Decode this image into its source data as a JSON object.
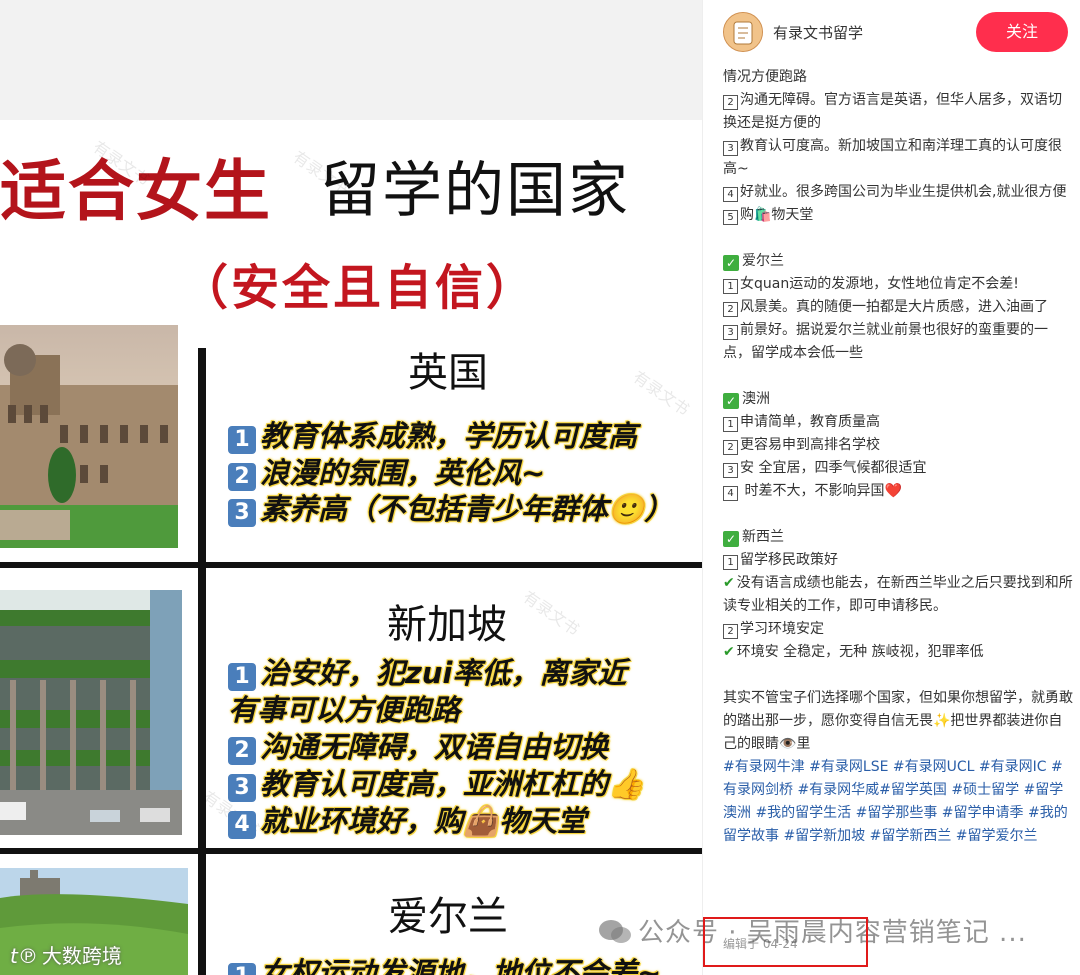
{
  "poster": {
    "title_red": "适合女生",
    "title_black": "留学的国家",
    "subtitle": "（安全且自信）",
    "watermark": "有录文书",
    "logo_watermark": "大数跨境",
    "sections": [
      {
        "country": "英国",
        "points": [
          "教育体系成熟，学历认可度高",
          "浪漫的氛围，英伦风~",
          "素养高（不包括青少年群体🙂）"
        ]
      },
      {
        "country": "新加坡",
        "points": [
          "治安好，犯zui率低，离家近",
          "有事可以方便跑路",
          "沟通无障碍，双语自由切换",
          "教育认可度高，亚洲杠杠的👍",
          "就业环境好，购👜物天堂"
        ]
      },
      {
        "country": "爱尔兰",
        "points": [
          "女权运动发源地，地位不会差~"
        ]
      }
    ]
  },
  "header": {
    "author": "有录文书留学",
    "follow_label": "关注"
  },
  "post": {
    "lines_top": [
      "情况方便跑路"
    ],
    "sg_items": [
      {
        "n": "2",
        "text": "沟通无障碍。官方语言是英语，但华人居多，双语切换还是挺方便的"
      },
      {
        "n": "3",
        "text": "教育认可度高。新加坡国立和南洋理工真的认可度很高~"
      },
      {
        "n": "4",
        "text": "好就业。很多跨国公司为毕业生提供机会,就业很方便"
      },
      {
        "n": "5",
        "text": "购🛍️物天堂"
      }
    ],
    "ireland_title": "爱尔兰",
    "ireland_items": [
      {
        "n": "1",
        "text": "女quan运动的发源地，女性地位肯定不会差!"
      },
      {
        "n": "2",
        "text": "风景美。真的随便一拍都是大片质感，进入油画了"
      },
      {
        "n": "3",
        "text": "前景好。据说爱尔兰就业前景也很好的蛮重要的一点，留学成本会低一些"
      }
    ],
    "australia_title": "澳洲",
    "australia_items": [
      {
        "n": "1",
        "text": "申请简单，教育质量高"
      },
      {
        "n": "2",
        "text": "更容易申到高排名学校"
      },
      {
        "n": "3",
        "text": "安 全宜居，四季气候都很适宜"
      },
      {
        "n": "4",
        "text": " 时差不大，不影响异国❤️"
      }
    ],
    "nz_title": "新西兰",
    "nz_items": [
      {
        "type": "box",
        "n": "1",
        "text": "留学移民政策好"
      },
      {
        "type": "tick",
        "text": "没有语言成绩也能去，在新西兰毕业之后只要找到和所读专业相关的工作，即可申请移民。"
      },
      {
        "type": "box",
        "n": "2",
        "text": "学习环境安定"
      },
      {
        "type": "tick",
        "text": "环境安 全稳定，无种 族岐视，犯罪率低"
      }
    ],
    "closing": "其实不管宝子们选择哪个国家，但如果你想留学，就勇敢的踏出那一步，愿你变得自信无畏✨把世界都装进你自己的眼睛👁️里",
    "tags": "#有录网牛津 #有录网LSE #有录网UCL #有录网IC #有录网剑桥 #有录网华威#留学英国 #硕士留学 #留学澳洲 #我的留学生活 #留学那些事 #留学申请季 #我的留学故事 #留学新加坡 #留学新西兰 #留学爱尔兰",
    "edited": "编辑于 04-24"
  },
  "overlay": {
    "gzh_text": "公众号 · 吴雨晨内容营销笔记 ..."
  },
  "colors": {
    "follow_bg": "#ff2e4d",
    "tag_blue": "#2a5ea8",
    "title_red": "#b3141b",
    "highlight_box": "#e01a1a"
  }
}
